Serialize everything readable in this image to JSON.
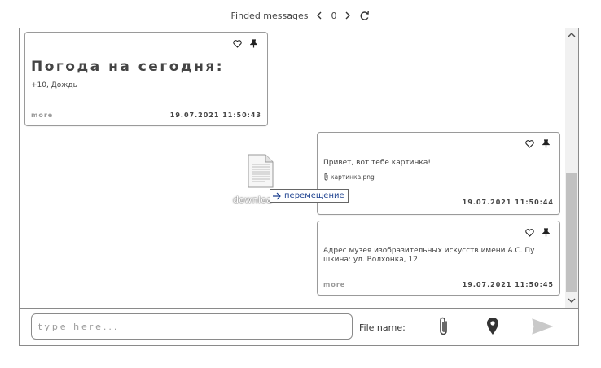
{
  "search": {
    "label": "Finded messages",
    "count": "0"
  },
  "messages": [
    {
      "title": "Погода на сегодня:",
      "text": "+10, Дождь",
      "more": "more",
      "time": "19.07.2021 11:50:43"
    },
    {
      "text": "Привет, вот тебе картинка!",
      "attachment": "картинка.png",
      "time": "19.07.2021 11:50:44"
    },
    {
      "text_line1": "Адрес музея изобразительных искусств имени А.С. Пу",
      "text_line2": "шкина: ул. Волхонка, 12",
      "more": "more",
      "time": "19.07.2021 11:50:45"
    }
  ],
  "drag": {
    "file_label": "downloa",
    "tooltip": "перемещение"
  },
  "composer": {
    "placeholder": "type here...",
    "file_name_label": "File name:"
  },
  "icons": {
    "prev": "chevron-left-icon",
    "next": "chevron-right-icon",
    "refresh": "refresh-icon",
    "favorite": "heart-icon",
    "pin": "pin-icon",
    "attach": "paperclip-icon",
    "location": "location-pin-icon",
    "send": "send-icon"
  },
  "colors": {
    "tooltip_text": "#1a3f8e",
    "border": "#8a8a8a"
  }
}
